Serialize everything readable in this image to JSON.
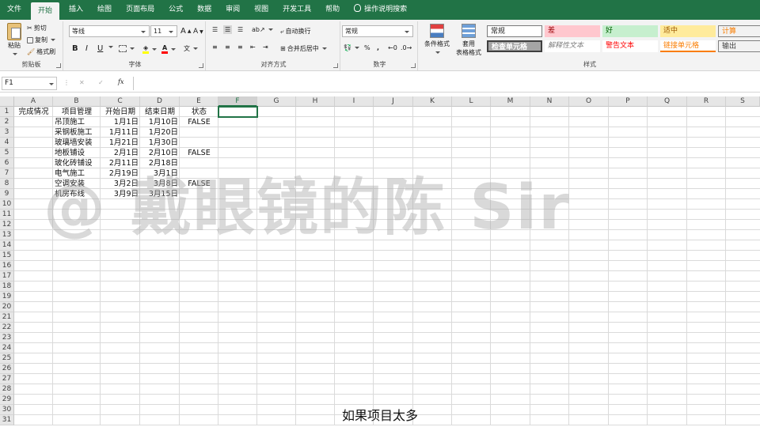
{
  "tabs": [
    "文件",
    "开始",
    "插入",
    "绘图",
    "页面布局",
    "公式",
    "数据",
    "审阅",
    "视图",
    "开发工具",
    "帮助",
    "操作说明搜索"
  ],
  "clipboard": {
    "paste": "粘贴",
    "cut": "剪切",
    "copy": "复制",
    "format_painter": "格式刷",
    "label": "剪贴板"
  },
  "font": {
    "name": "等线",
    "size": "11",
    "grow": "A",
    "shrink": "A",
    "bold": "B",
    "italic": "I",
    "underline": "U",
    "label": "字体"
  },
  "alignment": {
    "wrap": "自动换行",
    "merge": "合并后居中",
    "label": "对齐方式"
  },
  "number": {
    "format": "常规",
    "percent": "%",
    "comma": ",",
    "label": "数字"
  },
  "styles": {
    "conditional": "条件格式",
    "table_format_1": "套用",
    "table_format_2": "表格格式",
    "items": [
      {
        "text": "常规",
        "bg": "#ffffff",
        "fg": "#222222"
      },
      {
        "text": "差",
        "bg": "#ffc7ce",
        "fg": "#9c0006"
      },
      {
        "text": "好",
        "bg": "#c6efce",
        "fg": "#006100"
      },
      {
        "text": "适中",
        "bg": "#ffeb9c",
        "fg": "#9c5700"
      },
      {
        "text": "计算",
        "bg": "#f2f2f2",
        "fg": "#fa7d00"
      },
      {
        "text": "检查单元格",
        "bg": "#a5a5a5",
        "fg": "#ffffff"
      },
      {
        "text": "解释性文本",
        "bg": "#ffffff",
        "fg": "#7f7f7f"
      },
      {
        "text": "警告文本",
        "bg": "#ffffff",
        "fg": "#ff0000"
      },
      {
        "text": "链接单元格",
        "bg": "#ffffff",
        "fg": "#fa7d00"
      },
      {
        "text": "输出",
        "bg": "#f2f2f2",
        "fg": "#3f3f3f"
      }
    ],
    "label": "样式"
  },
  "formula_bar": {
    "name_box": "F1",
    "fx": "fx",
    "value": ""
  },
  "columns": [
    "A",
    "B",
    "C",
    "D",
    "E",
    "F",
    "G",
    "H",
    "I",
    "J",
    "K",
    "L",
    "M",
    "N",
    "O",
    "P",
    "Q",
    "R",
    "S"
  ],
  "selected_column": "F",
  "row_count": 31,
  "headers": [
    "完成情况",
    "项目管理",
    "开始日期",
    "结束日期",
    "状态"
  ],
  "rows": [
    [
      "",
      "吊顶施工",
      "1月1日",
      "1月10日",
      "FALSE"
    ],
    [
      "",
      "采钢板施工",
      "1月11日",
      "1月20日",
      ""
    ],
    [
      "",
      "玻璃墙安装",
      "1月21日",
      "1月30日",
      ""
    ],
    [
      "",
      "地板铺设",
      "2月1日",
      "2月10日",
      "FALSE"
    ],
    [
      "",
      "玻化砖铺设",
      "2月11日",
      "2月18日",
      ""
    ],
    [
      "",
      "电气施工",
      "2月19日",
      "3月1日",
      ""
    ],
    [
      "",
      "空调安装",
      "3月2日",
      "3月8日",
      "FALSE"
    ],
    [
      "",
      "机房布线",
      "3月9日",
      "3月15日",
      ""
    ]
  ],
  "watermark": "@ 戴眼镜的陈 Sir",
  "subtitle": "如果项目太多"
}
